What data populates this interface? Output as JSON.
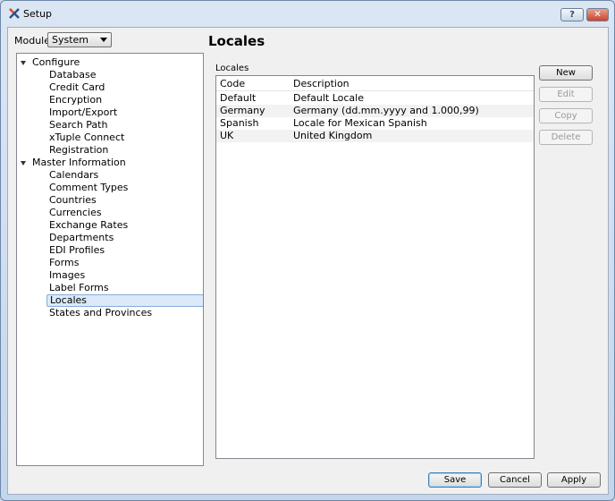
{
  "window": {
    "title": "Setup",
    "help_label": "?",
    "close_label": "✕"
  },
  "module": {
    "label": "Module:",
    "value": "System"
  },
  "tree": [
    {
      "label": "Configure",
      "kind": "group"
    },
    {
      "label": "Database",
      "kind": "child"
    },
    {
      "label": "Credit Card",
      "kind": "child"
    },
    {
      "label": "Encryption",
      "kind": "child"
    },
    {
      "label": "Import/Export",
      "kind": "child"
    },
    {
      "label": "Search Path",
      "kind": "child"
    },
    {
      "label": "xTuple Connect",
      "kind": "child"
    },
    {
      "label": "Registration",
      "kind": "child"
    },
    {
      "label": "Master Information",
      "kind": "group"
    },
    {
      "label": "Calendars",
      "kind": "child"
    },
    {
      "label": "Comment Types",
      "kind": "child"
    },
    {
      "label": "Countries",
      "kind": "child"
    },
    {
      "label": "Currencies",
      "kind": "child"
    },
    {
      "label": "Exchange Rates",
      "kind": "child"
    },
    {
      "label": "Departments",
      "kind": "child"
    },
    {
      "label": "EDI Profiles",
      "kind": "child"
    },
    {
      "label": "Forms",
      "kind": "child"
    },
    {
      "label": "Images",
      "kind": "child"
    },
    {
      "label": "Label Forms",
      "kind": "child"
    },
    {
      "label": "Locales",
      "kind": "child",
      "selected": true
    },
    {
      "label": "States and Provinces",
      "kind": "child"
    }
  ],
  "page": {
    "title": "Locales",
    "table_label": "Locales"
  },
  "table": {
    "columns": [
      "Code",
      "Description"
    ],
    "rows": [
      [
        "Default",
        "Default Locale"
      ],
      [
        "Germany",
        "Germany (dd.mm.yyyy and 1.000,99)"
      ],
      [
        "Spanish",
        "Locale for Mexican Spanish"
      ],
      [
        "UK",
        "United Kingdom"
      ]
    ]
  },
  "side_buttons": [
    {
      "label": "New",
      "enabled": true
    },
    {
      "label": "Edit",
      "enabled": false
    },
    {
      "label": "Copy",
      "enabled": false
    },
    {
      "label": "Delete",
      "enabled": false
    }
  ],
  "footer_buttons": [
    {
      "label": "Save",
      "default": true
    },
    {
      "label": "Cancel"
    },
    {
      "label": "Apply"
    }
  ],
  "colors": {
    "selection": "#dbe9f9",
    "selection_border": "#84acdd",
    "window_frame": "#c4d6ec"
  }
}
